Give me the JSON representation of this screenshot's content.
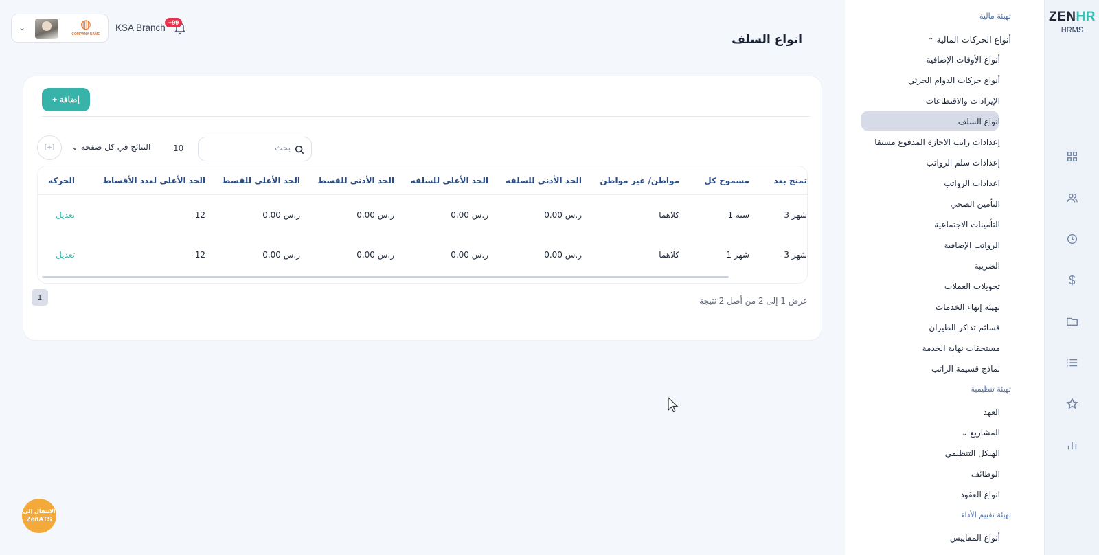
{
  "brand": {
    "logo_zen": "ZEN",
    "logo_hr": "HR",
    "product": "HRMS"
  },
  "rail": [
    "grid-icon",
    "users-icon",
    "clock-icon",
    "dollar-icon",
    "folder-icon",
    "list-icon",
    "star-icon",
    "bar-chart-icon"
  ],
  "sidebar": {
    "group_financial": "تهيئة مالية",
    "parent_financial": "أنواع الحركات المالية",
    "fin_items": [
      "أنواع الأوقات الإضافية",
      "أنواع حركات الدوام الجزئي",
      "الإيرادات والاقتطاعات",
      "انواع السلف",
      "إعدادات راتب الاجازة المدفوع مسبقا",
      "إعدادات سلم الرواتب",
      "اعدادات الرواتب",
      "التأمين الصحي",
      "التأمينات الاجتماعية",
      "الرواتب الإضافية",
      "الضريبة",
      "تحويلات العملات",
      "تهيئة إنهاء الخدمات",
      "قسائم تذاكر الطيران",
      "مستحقات نهاية الخدمة",
      "نماذج قسيمة الراتب"
    ],
    "group_org": "تهيئة تنظيمية",
    "org_items": [
      "العهد",
      "المشاريع",
      "الهيكل التنظيمي",
      "الوظائف",
      "انواع العقود"
    ],
    "group_perf": "تهيئة تقييم الأداء",
    "perf_items": [
      "أنواع المقاييس"
    ]
  },
  "header": {
    "company_name": "COMPANY NAME",
    "branch": "KSA Branch",
    "notifications": "+99"
  },
  "page": {
    "title": "انواع السلف",
    "add_label": "+ إضافة",
    "search_placeholder": "بحث",
    "per_page_value": "10",
    "per_page_label": "النتائج في كل صفحة",
    "export_label": "[+]",
    "summary": "عرض 1 إلى 2 من أصل 2 نتيجة",
    "current_page": "1"
  },
  "table": {
    "headers": [
      "تمنح بعد",
      "مسموح كل",
      "مواطن/ غير مواطن",
      "الحد الأدنى للسلفه",
      "الحد الأعلى للسلفه",
      "الحد الأدنى للقسط",
      "الحد الأعلى للقسط",
      "الحد الأعلى لعدد الأقساط",
      "الحركه"
    ],
    "rows": [
      [
        "3 شهر",
        "1 سنة",
        "كلاهما",
        "0.00 ر.س",
        "0.00 ر.س",
        "0.00 ر.س",
        "0.00 ر.س",
        "12",
        "تعديل"
      ],
      [
        "3 شهر",
        "1 شهر",
        "كلاهما",
        "0.00 ر.س",
        "0.00 ر.س",
        "0.00 ر.س",
        "0.00 ر.س",
        "12",
        "تعديل"
      ]
    ]
  },
  "ats_button": {
    "line1": "الانتقال إلى",
    "line2": "ZenATS"
  },
  "colors": {
    "accent": "#37b3aa",
    "badge": "#e5354f",
    "ats": "#f4a93b",
    "header_text": "#2a4c86"
  }
}
